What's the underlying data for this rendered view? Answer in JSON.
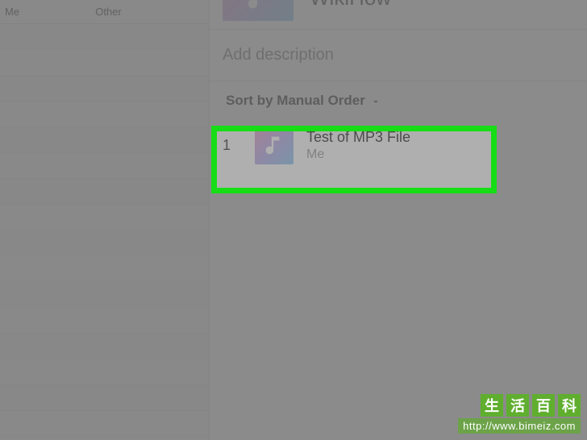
{
  "sidebar": {
    "tab_left": "Me",
    "tab_right": "Other"
  },
  "playlist": {
    "title": "WikiHow",
    "description_placeholder": "Add description",
    "sort_label": "Sort by Manual Order"
  },
  "tracks": [
    {
      "index": "1",
      "title": "Test of MP3 File",
      "artist": "Me"
    }
  ],
  "watermark": {
    "chars": [
      "生",
      "活",
      "百",
      "科"
    ],
    "url": "http://www.bimeiz.com"
  },
  "icons": {
    "music": "music-note-icon",
    "chevron": "chevron-down-icon"
  }
}
